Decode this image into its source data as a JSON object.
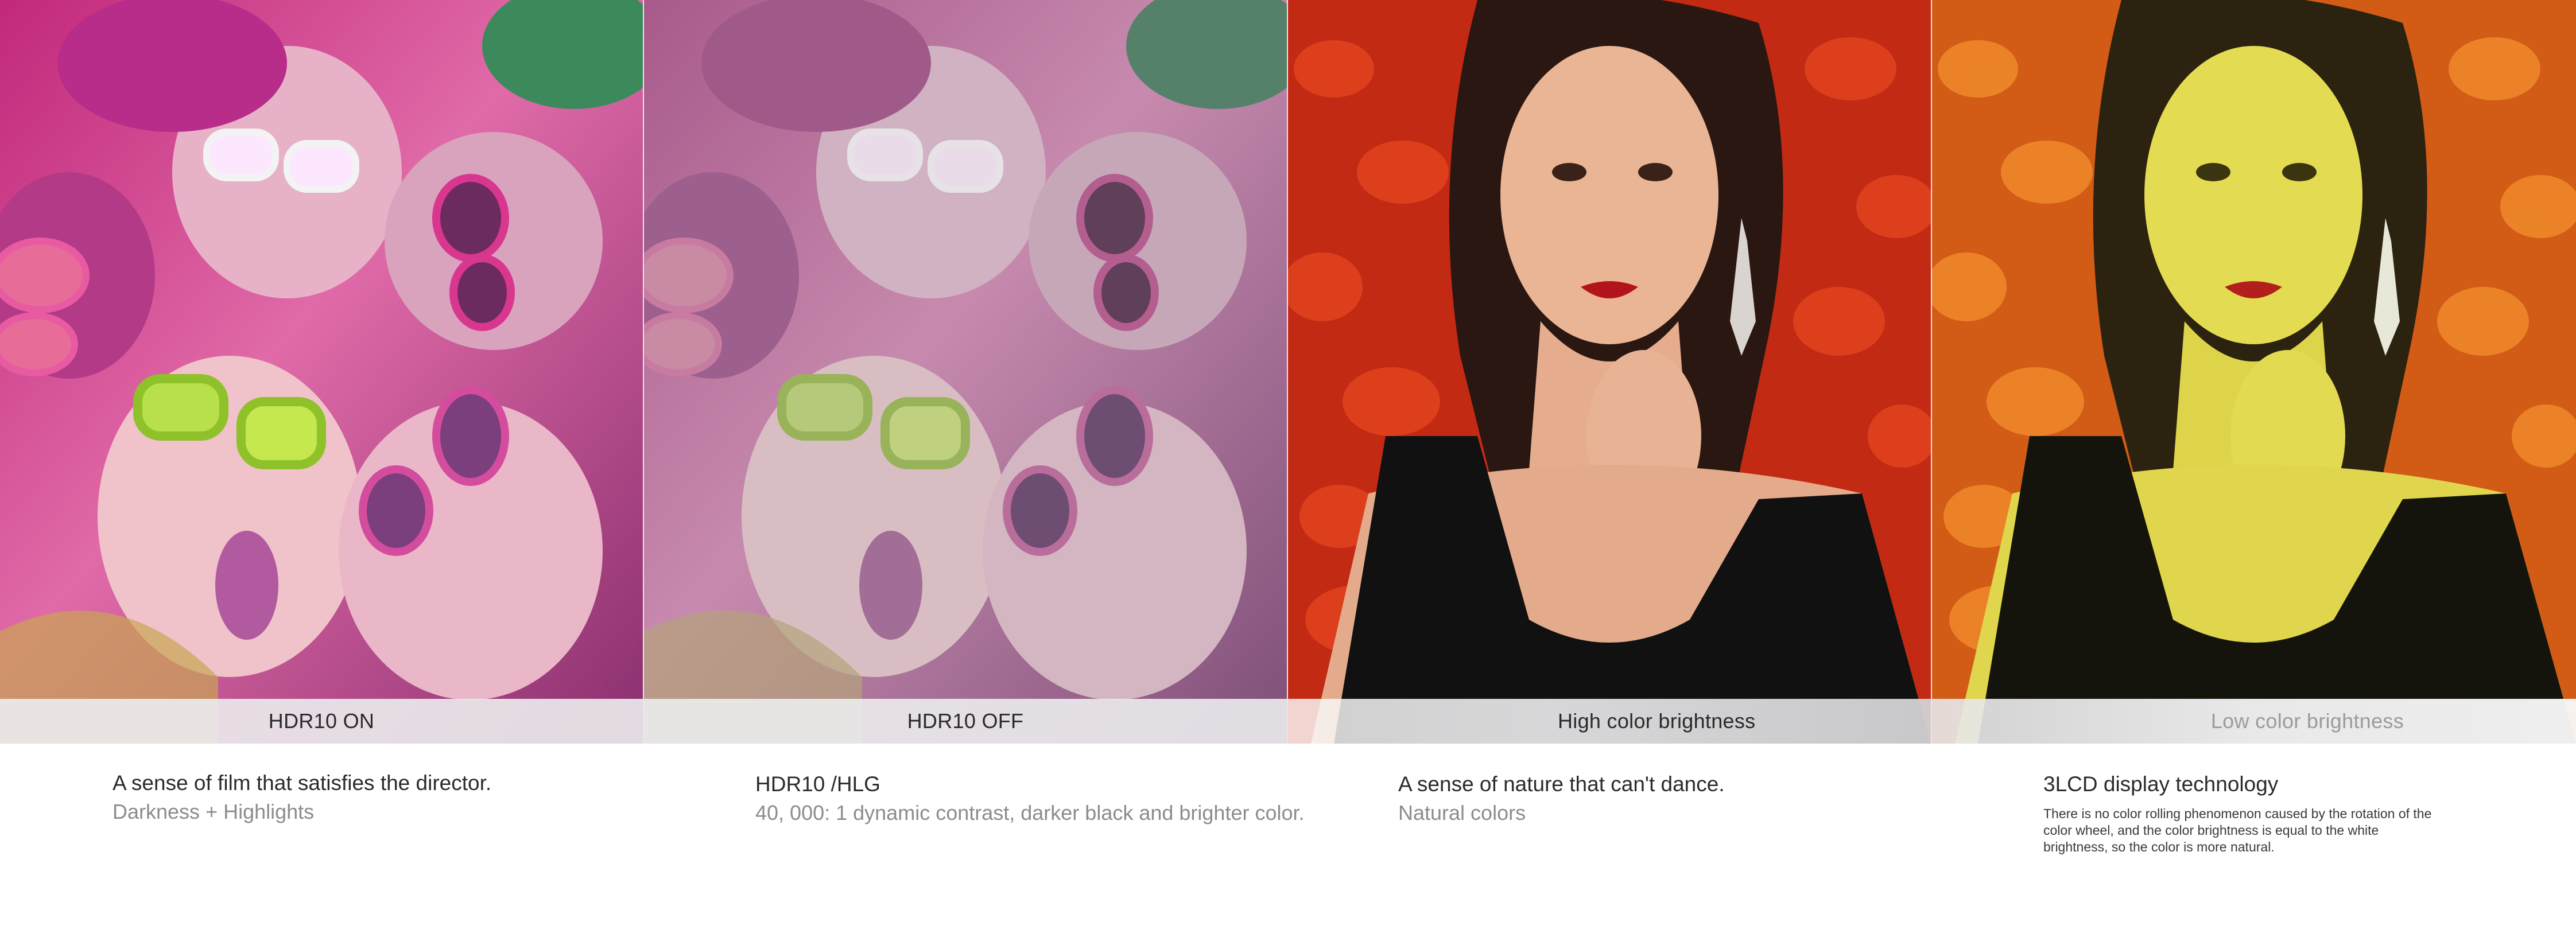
{
  "panels": [
    {
      "caption": "HDR10 ON"
    },
    {
      "caption": "HDR10 OFF"
    },
    {
      "caption": "High color brightness"
    },
    {
      "caption": "Low color brightness"
    }
  ],
  "descriptions": [
    {
      "title": "A sense of film that satisfies the director.",
      "subtitle": "Darkness + Highlights"
    },
    {
      "title": "HDR10 /HLG",
      "subtitle": "40, 000: 1 dynamic contrast, darker black and brighter color."
    },
    {
      "title": "A sense of nature that can't dance.",
      "subtitle": "Natural colors"
    },
    {
      "title": "3LCD display technology",
      "note": "There is no color rolling phenomenon caused by the rotation of the color wheel, and the color brightness is equal to the white brightness, so the color is more natural."
    }
  ]
}
